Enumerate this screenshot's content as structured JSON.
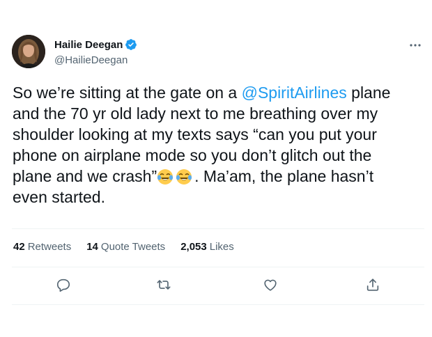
{
  "author": {
    "name": "Hailie Deegan",
    "handle": "@HailieDeegan",
    "verified": true
  },
  "tweet": {
    "text_line1_before": "So we’re sitting at the gate on a ",
    "mention": "@SpiritAirlines",
    "text_line1_after": " plane",
    "text_rest": "and the 70 yr old lady next to me breathing over my\nshoulder looking at my texts says “can you put your\nphone on airplane mode so you don’t glitch out the\nplane and we crash”",
    "text_after_emoji": ". Ma’am, the plane hasn’t\neven started."
  },
  "stats": {
    "retweets_count": "42",
    "retweets_label": "Retweets",
    "quotes_count": "14",
    "quotes_label": "Quote Tweets",
    "likes_count": "2,053",
    "likes_label": "Likes"
  },
  "icons": {
    "verified": "verified-badge-icon",
    "more": "more-icon",
    "reply": "reply-icon",
    "retweet": "retweet-icon",
    "like": "like-icon",
    "share": "share-icon",
    "emoji": "face-with-tears-of-joy-emoji"
  },
  "colors": {
    "accent": "#1d9bf0",
    "text": "#0f1419",
    "secondary": "#536471",
    "border": "#eff3f4"
  }
}
